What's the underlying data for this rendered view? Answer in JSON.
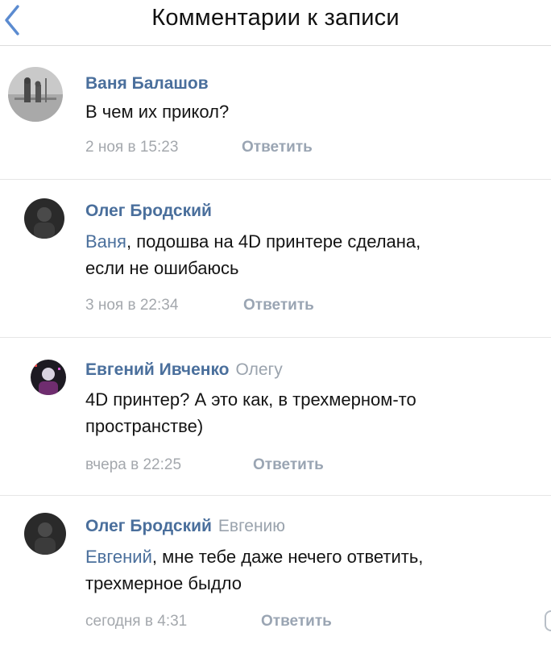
{
  "header": {
    "title": "Комментарии к записи"
  },
  "comments": [
    {
      "author": "Ваня Балашов",
      "reply_to": "",
      "mention": "",
      "lines": [
        "В чем их прикол?"
      ],
      "time": "2 ноя в 15:23",
      "reply_label": "Ответить"
    },
    {
      "author": "Олег Бродский",
      "reply_to": "",
      "mention": "Ваня",
      "lines": [
        ", подошва на 4D принтере сделана,",
        "если не ошибаюсь"
      ],
      "time": "3 ноя в 22:34",
      "reply_label": "Ответить"
    },
    {
      "author": "Евгений Ивченко",
      "reply_to": "Олегу",
      "mention": "",
      "lines": [
        "4D принтер? А это как, в трехмерном-то",
        "пространстве)"
      ],
      "time": "вчера в 22:25",
      "reply_label": "Ответить"
    },
    {
      "author": "Олег Бродский",
      "reply_to": "Евгению",
      "mention": "Евгений",
      "lines": [
        ", мне тебе даже нечего ответить,",
        "трехмерное быдло"
      ],
      "time": "сегодня в 4:31",
      "reply_label": "Ответить"
    }
  ],
  "colors": {
    "link": "#4a6f9c",
    "muted": "#a4a8ad",
    "back": "#5b8bd0"
  },
  "icons": {
    "back": "chevron-left-icon"
  }
}
